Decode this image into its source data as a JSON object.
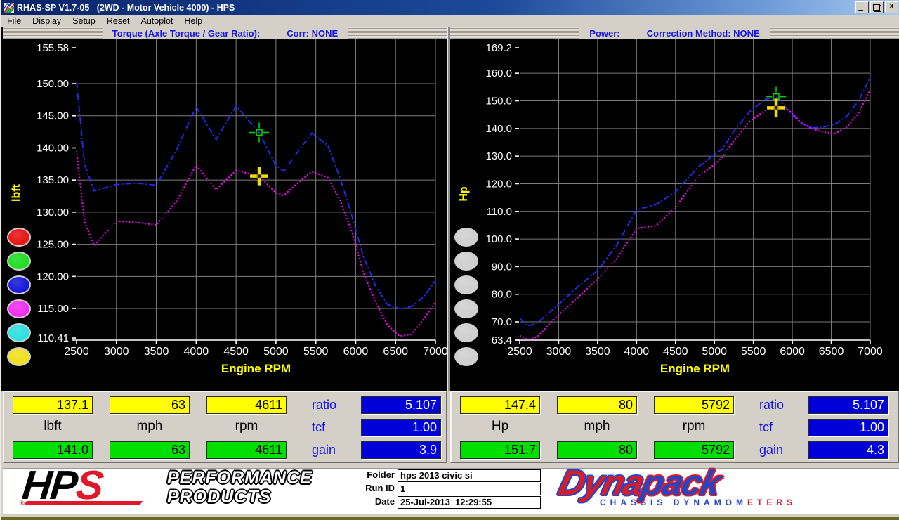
{
  "window": {
    "title": "RHAS-SP V1.7-05   (2WD - Motor Vehicle 4000) - HPS",
    "menu": [
      "File",
      "Display",
      "Setup",
      "Reset",
      "Autoplot",
      "Help"
    ]
  },
  "panels": [
    {
      "header": "Torque (Axle Torque / Gear Ratio):",
      "header_right": "Corr: NONE",
      "ylabel": "lbft",
      "xlabel": "Engine RPM",
      "trace_buttons": [
        "#e81616",
        "#22dd22",
        "#1a1ad8",
        "#f030f0",
        "#30e0e0",
        "#f0e020"
      ]
    },
    {
      "header": "Power:",
      "header_right": "Correction Method: NONE",
      "ylabel": "Hp",
      "xlabel": "Engine RPM",
      "trace_buttons": [
        "#d0d0d0",
        "#d0d0d0",
        "#d0d0d0",
        "#d0d0d0",
        "#d0d0d0",
        "#d0d0d0"
      ]
    }
  ],
  "readouts": {
    "left": {
      "primary_value": "137.1",
      "speed_value": "63",
      "rpm_value": "4611",
      "primary_unit": "lbft",
      "speed_unit": "mph",
      "rpm_unit": "rpm",
      "secondary_value": "141.0",
      "secondary_speed": "63",
      "secondary_rpm": "4611",
      "ratio_label": "ratio",
      "ratio_value": "5.107",
      "tcf_label": "tcf",
      "tcf_value": "1.00",
      "gain_label": "gain",
      "gain_value": "3.9"
    },
    "right": {
      "primary_value": "147.4",
      "speed_value": "80",
      "rpm_value": "5792",
      "primary_unit": "Hp",
      "speed_unit": "mph",
      "rpm_unit": "rpm",
      "secondary_value": "151.7",
      "secondary_speed": "80",
      "secondary_rpm": "5792",
      "ratio_label": "ratio",
      "ratio_value": "5.107",
      "tcf_label": "tcf",
      "tcf_value": "1.00",
      "gain_label": "gain",
      "gain_value": "4.3"
    }
  },
  "footer": {
    "hps": {
      "hp": "HP",
      "s": "S",
      "reg": "®",
      "line1": "PERFORMANCE",
      "line2": "PRODUCTS"
    },
    "fields": {
      "folder_label": "Folder",
      "folder_value": "hps 2013 civic si",
      "run_label": "Run ID",
      "run_value": "1",
      "date_label": "Date",
      "date_value": "25-Jul-2013  12:29:55"
    },
    "dynapack": {
      "part1": "Dyna",
      "part2": "pack",
      "tag1": "CHASSIS ",
      "tag2_blue": "DYNAMOM",
      "tag2_red": "ETERS"
    }
  },
  "chart_data": [
    {
      "type": "line",
      "title": "Torque (Axle Torque / Gear Ratio): Corr: NONE",
      "xlabel": "Engine RPM",
      "ylabel": "lbft",
      "xlim": [
        2500,
        7000
      ],
      "ylim": [
        110.41,
        155.58
      ],
      "grid": true,
      "legend": "none",
      "xtick_labels": [
        "2500",
        "3000",
        "3500",
        "4000",
        "4500",
        "5000",
        "5500",
        "6000",
        "6500",
        "7000"
      ],
      "ytick_labels": [
        "155.58",
        "150.00",
        "145.00",
        "140.00",
        "135.00",
        "130.00",
        "125.00",
        "120.00",
        "115.00",
        "110.41"
      ],
      "x": [
        2500,
        2600,
        2720,
        3000,
        3250,
        3500,
        3750,
        4000,
        4250,
        4500,
        4790,
        5000,
        5100,
        5250,
        5450,
        5650,
        5800,
        5950,
        6100,
        6250,
        6400,
        6550,
        6700,
        6850,
        7000
      ],
      "series": [
        {
          "name": "corrected-run-blue",
          "color": "#2828ff",
          "style": "dash-dot",
          "values": [
            150.3,
            137.5,
            133.3,
            134.3,
            134.5,
            134.2,
            139.6,
            146.4,
            141.3,
            146.5,
            142.4,
            137.2,
            136.4,
            139.0,
            142.3,
            140.4,
            135.5,
            129.5,
            123.0,
            118.5,
            115.6,
            115.0,
            115.3,
            116.8,
            119.3
          ]
        },
        {
          "name": "measured-run-magenta",
          "color": "#ff00ff",
          "style": "dotted",
          "values": [
            139.5,
            128.5,
            124.8,
            128.6,
            128.4,
            128.0,
            131.6,
            137.3,
            133.5,
            136.5,
            135.6,
            133.0,
            132.6,
            134.3,
            136.3,
            135.4,
            132.0,
            127.0,
            120.5,
            116.0,
            112.4,
            110.7,
            111.0,
            113.3,
            116.0
          ]
        }
      ],
      "cursors": [
        {
          "shape": "green-square",
          "x": 4790,
          "y": 142.4
        },
        {
          "shape": "yellow-cross",
          "x": 4790,
          "y": 135.6
        }
      ]
    },
    {
      "type": "line",
      "title": "Power: Correction Method: NONE",
      "xlabel": "Engine RPM",
      "ylabel": "Hp",
      "xlim": [
        2500,
        7000
      ],
      "ylim": [
        63.4,
        169.2
      ],
      "grid": true,
      "legend": "none",
      "xtick_labels": [
        "2500",
        "3000",
        "3500",
        "4000",
        "4500",
        "5000",
        "5500",
        "6000",
        "6500",
        "7000"
      ],
      "ytick_labels": [
        "169.2",
        "160.0",
        "150.0",
        "140.0",
        "130.0",
        "120.0",
        "110.0",
        "100.0",
        "90.0",
        "80.0",
        "70.0",
        "63.4"
      ],
      "x": [
        2500,
        2600,
        2720,
        3000,
        3250,
        3500,
        3750,
        4000,
        4250,
        4500,
        4790,
        5000,
        5100,
        5250,
        5450,
        5650,
        5800,
        5950,
        6100,
        6250,
        6400,
        6550,
        6700,
        6850,
        7000
      ],
      "series": [
        {
          "name": "corrected-run-blue",
          "color": "#2828ff",
          "style": "dash-dot",
          "values": [
            71.3,
            68.5,
            69.5,
            76.3,
            82.8,
            88.5,
            98.0,
            110.5,
            112.5,
            117.0,
            126.0,
            130.5,
            132.5,
            139.0,
            146.0,
            150.5,
            151.5,
            146.5,
            142.0,
            140.2,
            140.5,
            141.5,
            144.5,
            150.0,
            158.5
          ]
        },
        {
          "name": "measured-run-magenta",
          "color": "#ff00ff",
          "style": "dotted",
          "values": [
            65.0,
            63.6,
            64.5,
            72.5,
            79.0,
            85.5,
            93.0,
            103.8,
            104.8,
            111.5,
            122.5,
            127.0,
            129.5,
            135.5,
            142.5,
            146.5,
            147.5,
            146.8,
            142.5,
            139.9,
            138.7,
            138.2,
            140.5,
            145.5,
            154.0
          ]
        }
      ],
      "cursors": [
        {
          "shape": "green-square",
          "x": 5792,
          "y": 151.5
        },
        {
          "shape": "yellow-cross",
          "x": 5792,
          "y": 147.5
        }
      ]
    }
  ]
}
